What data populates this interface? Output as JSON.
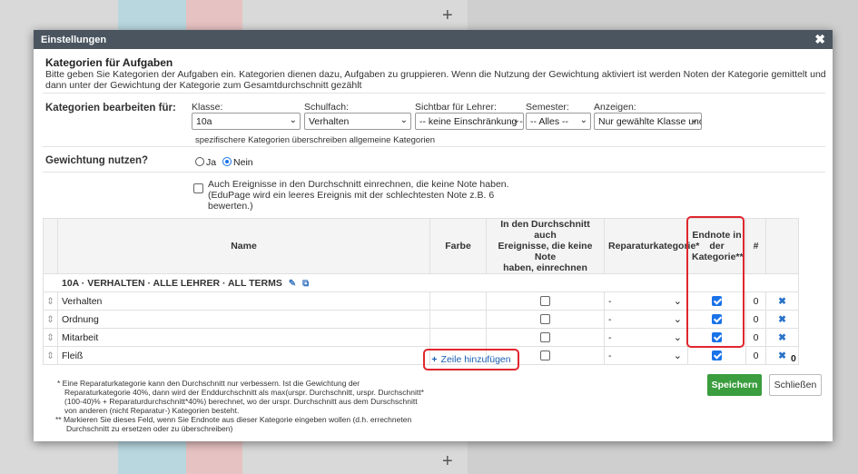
{
  "dialog": {
    "title": "Einstellungen",
    "close_icon": "close-icon",
    "section_title": "Kategorien für Aufgaben",
    "section_desc": "Bitte geben Sie Kategorien der Aufgaben ein. Kategorien dienen dazu, Aufgaben zu gruppieren. Wenn die Nutzung der Gewichtung aktiviert ist werden Noten der Kategorie gemittelt und dann unter der Gewichtung der Kategorie zum Gesamtdurchschnitt gezählt"
  },
  "filters": {
    "heading": "Kategorien bearbeiten für:",
    "klasse_label": "Klasse:",
    "klasse_value": "10a",
    "schulfach_label": "Schulfach:",
    "schulfach_value": "Verhalten",
    "sichtbar_label": "Sichtbar für Lehrer:",
    "sichtbar_value": "-- keine Einschränkung --",
    "semester_label": "Semester:",
    "semester_value": "-- Alles --",
    "anzeigen_label": "Anzeigen:",
    "anzeigen_value": "Nur gewählte Klasse und Fach",
    "note": "spezifischere Kategorien überschreiben allgemeine Kategorien"
  },
  "weighting": {
    "label": "Gewichtung nutzen?",
    "yes": "Ja",
    "no": "Nein",
    "selected": "Nein",
    "include_text_1": "Auch Ereignisse in den Durchschnitt einrechnen, die keine Note haben.",
    "include_text_2": "(EduPage wird ein leeres Ereignis mit der schlechtesten Note z.B. 6",
    "include_text_3": "bewerten.)"
  },
  "table": {
    "headers": {
      "name": "Name",
      "farbe": "Farbe",
      "include_1": "In den Durchschnitt auch",
      "include_2": "Ereignisse, die keine Note",
      "include_3": "haben, einrechnen",
      "repair": "Reparaturkategorie*",
      "final_1": "Endnote in",
      "final_2": "der",
      "final_3": "Kategorie**",
      "count": "#"
    },
    "group_label": "10A · VERHALTEN · ALLE LEHRER · ALL TERMS",
    "rows": [
      {
        "name": "Verhalten",
        "repair": "-",
        "include": false,
        "final": true,
        "count": "0"
      },
      {
        "name": "Ordnung",
        "repair": "-",
        "include": false,
        "final": true,
        "count": "0"
      },
      {
        "name": "Mitarbeit",
        "repair": "-",
        "include": false,
        "final": true,
        "count": "0"
      },
      {
        "name": "Fleiß",
        "repair": "-",
        "include": false,
        "final": true,
        "count": "0"
      }
    ],
    "total": "0",
    "add_row": "Zeile hinzufügen"
  },
  "footnotes": {
    "f1_1": "*  Eine Reparaturkategorie kann den Durchschnitt nur verbessern. Ist die Gewichtung der",
    "f1_2": "Reparaturkategorie 40%, dann wird der Enddurchschnitt als max(urspr. Durchschnitt, urspr. Durchschnitt*",
    "f1_3": "(100-40)% + Reparaturdurchschnitt*40%) berechnet, wo der urspr. Durchschnitt aus dem Durschschnitt",
    "f1_4": "von anderen (nicht Reparatur-) Kategorien besteht.",
    "f2_1": "**  Markieren Sie dieses Feld, wenn Sie Endnote aus dieser Kategorie eingeben wollen (d.h. errechneten",
    "f2_2": "Durchschnitt zu ersetzen oder zu überschreiben)"
  },
  "buttons": {
    "save": "Speichern",
    "close": "Schließen"
  },
  "colors": {
    "header_bg": "#4a5560",
    "save_green": "#3a9d3e",
    "highlight_red": "#e0262e",
    "link_blue": "#1a5fb4"
  }
}
